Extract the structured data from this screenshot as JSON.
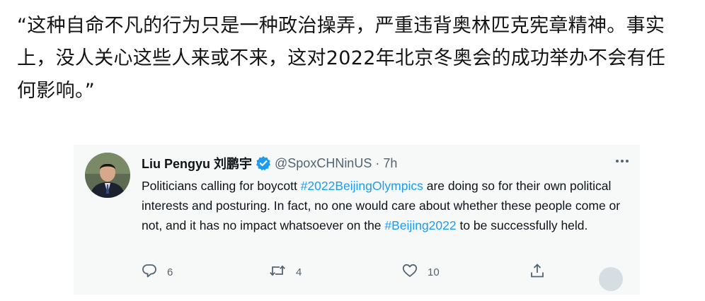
{
  "article": {
    "quote_text": "“这种自命不凡的行为只是一种政治操弄，严重违背奥林匹克宪章精神。事实上，没人关心这些人来或不来，这对2022年北京冬奥会的成功举办不会有任何影响。”"
  },
  "tweet": {
    "display_name": "Liu Pengyu 刘鹏宇",
    "handle": "@SpoxCHNinUS",
    "separator": "·",
    "time": "7h",
    "body_part1": "Politicians calling for boycott ",
    "hashtag1": "#2022BeijingOlympics",
    "body_part2": " are doing so for their own political interests and posturing. In fact, no one would care about whether these people come or not, and it has no impact whatsoever on the ",
    "hashtag2": "#Beijing2022",
    "body_part3": " to be successfully held.",
    "reply_count": "6",
    "retweet_count": "4",
    "like_count": "10"
  },
  "icons": {
    "verified": "verified-badge-icon",
    "more": "more-options-icon",
    "reply": "reply-icon",
    "retweet": "retweet-icon",
    "like": "heart-icon",
    "share": "share-icon"
  },
  "colors": {
    "link": "#1d9bf0",
    "muted": "#536471",
    "card_bg": "#f7f9f9"
  }
}
